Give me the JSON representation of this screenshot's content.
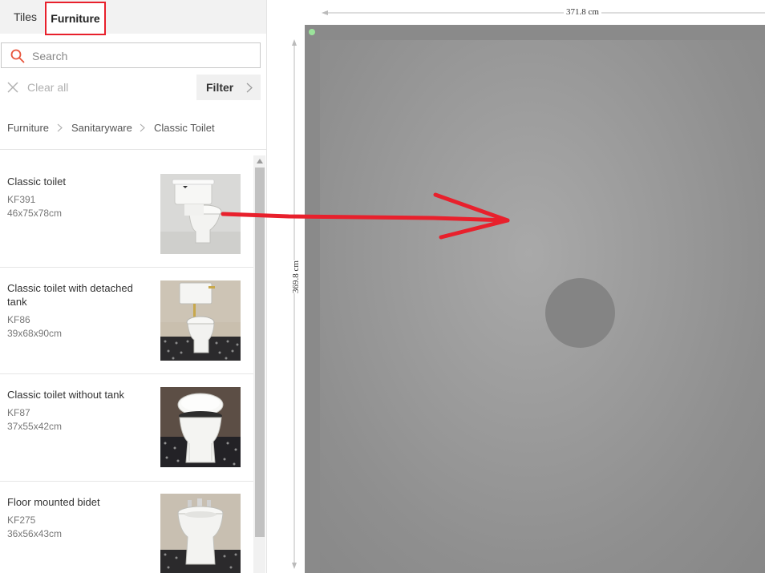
{
  "tabs": {
    "tiles": "Tiles",
    "furniture": "Furniture"
  },
  "search": {
    "placeholder": "Search",
    "value": ""
  },
  "clear_all": "Clear all",
  "filter": "Filter",
  "breadcrumb": [
    "Furniture",
    "Sanitaryware",
    "Classic Toilet"
  ],
  "products": [
    {
      "name": "Classic toilet",
      "code": "KF391",
      "size": "46x75x78cm"
    },
    {
      "name": "Classic toilet with detached tank",
      "code": "KF86",
      "size": "39x68x90cm"
    },
    {
      "name": "Classic toilet without tank",
      "code": "KF87",
      "size": "37x55x42cm"
    },
    {
      "name": "Floor mounted bidet",
      "code": "KF275",
      "size": "36x56x43cm"
    }
  ],
  "dimensions": {
    "width": "371.8 cm",
    "height": "369.8 cm"
  },
  "colors": {
    "highlight": "#e8202c",
    "search_icon": "#e8553c",
    "arrow": "#e8202c"
  },
  "icons": {
    "search": "search-icon",
    "clear": "close-icon",
    "filter": "chevron-right-icon",
    "breadcrumb_sep": "chevron-right-icon"
  }
}
